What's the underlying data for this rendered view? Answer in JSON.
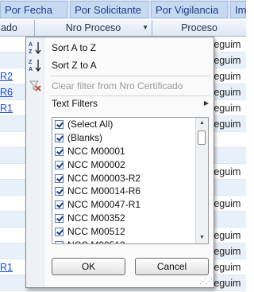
{
  "tabs": [
    "Por Fecha",
    "Por Solicitante",
    "Por Vigilancia",
    "Im"
  ],
  "header": {
    "col1": "ado",
    "col2": "Nro Proceso",
    "col3": "Proceso"
  },
  "grid_rows": [
    {
      "left": "",
      "right": "Seguim"
    },
    {
      "left": "",
      "right": "Seguim"
    },
    {
      "left": "R2",
      "right": "Seguim"
    },
    {
      "left": "R6",
      "right": "Seguim"
    },
    {
      "left": "R1",
      "right": "Seguim"
    },
    {
      "left": "",
      "right": "Seguim"
    },
    {
      "left": "",
      "right": ""
    },
    {
      "left": "",
      "right": ""
    },
    {
      "left": "",
      "right": "Seguim"
    },
    {
      "left": "",
      "right": ""
    },
    {
      "left": "",
      "right": "Seguim"
    },
    {
      "left": "",
      "right": ""
    },
    {
      "left": "",
      "right": "Seguim"
    },
    {
      "left": "",
      "right": "Seguim"
    },
    {
      "left": "R1",
      "right": "Seguim"
    },
    {
      "left": "",
      "right": "Seguim"
    }
  ],
  "menu": {
    "sort_asc": "Sort A to Z",
    "sort_desc": "Sort Z to A",
    "clear_filter": "Clear filter from Nro Certificado",
    "text_filters": "Text Filters"
  },
  "filter_list": [
    "(Select All)",
    "(Blanks)",
    "NCC M00001",
    "NCC M00002",
    "NCC M00003-R2",
    "NCC M00014-R6",
    "NCC M00047-R1",
    "NCC M00352",
    "NCC M00512",
    "NCC M00513"
  ],
  "buttons": {
    "ok": "OK",
    "cancel": "Cancel"
  }
}
